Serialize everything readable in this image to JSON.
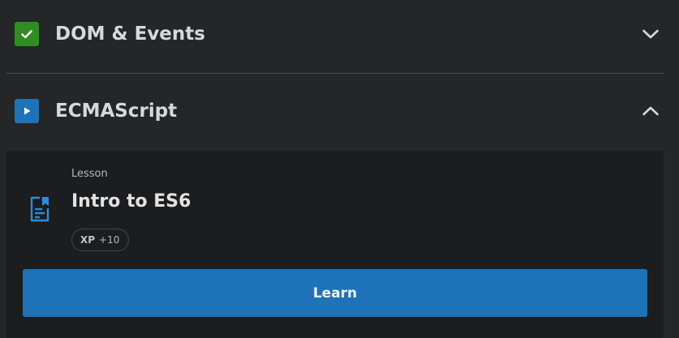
{
  "sections": [
    {
      "title": "DOM & Events",
      "status": "completed",
      "status_icon": "check-icon",
      "expanded": false,
      "chevron_icon": "chevron-down-icon"
    },
    {
      "title": "ECMAScript",
      "status": "in-progress",
      "status_icon": "play-icon",
      "expanded": true,
      "chevron_icon": "chevron-up-icon"
    }
  ],
  "lesson": {
    "type_label": "Lesson",
    "title": "Intro to ES6",
    "icon": "document-bookmark-icon",
    "xp_label": "XP",
    "xp_value": "+10",
    "button_label": "Learn"
  },
  "colors": {
    "background": "#252628",
    "card_background": "#1c1d1f",
    "completed_green": "#2f8d22",
    "accent_blue": "#1e73b8",
    "divider": "#4a4b4d"
  }
}
